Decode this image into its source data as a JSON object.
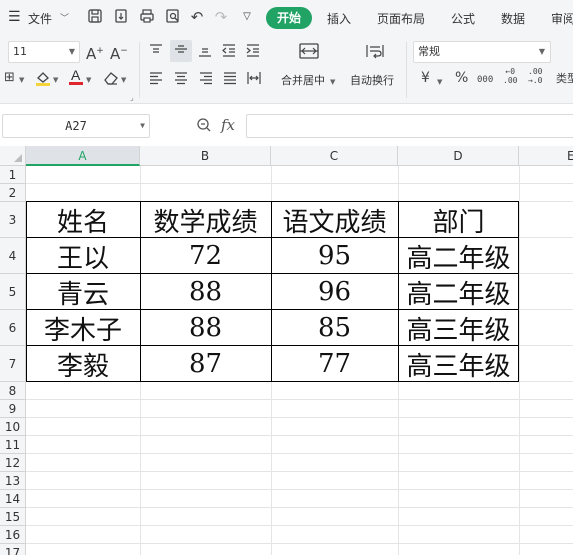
{
  "menubar": {
    "menu_icon": "hamburger-icon",
    "file_label": "文件",
    "tabs": [
      "开始",
      "插入",
      "页面布局",
      "公式",
      "数据",
      "审阅"
    ],
    "active_tab": "开始"
  },
  "ribbon": {
    "font_size": "11",
    "number_format": "常规",
    "merge_center_label": "合并居中",
    "wrap_text_label": "自动换行",
    "currency_symbol": "¥",
    "percent_symbol": "%",
    "thousands_symbol": "000",
    "inc_decimal": "←0\n.00",
    "dec_decimal": ".00\n→.0",
    "more_label": "类型",
    "font_color": "#e0262d",
    "fill_color": "#f5d33a",
    "accent_color": "#21a366"
  },
  "formula_bar": {
    "name_box": "A27",
    "fx_label": "fx",
    "formula": ""
  },
  "sheet": {
    "columns": [
      "A",
      "B",
      "C",
      "D",
      "E"
    ],
    "selected_column": "A",
    "rows": [
      "1",
      "2",
      "3",
      "4",
      "5",
      "6",
      "7",
      "8",
      "9",
      "10",
      "11",
      "12",
      "13",
      "14",
      "15",
      "16",
      "17"
    ],
    "headers": [
      "姓名",
      "数学成绩",
      "语文成绩",
      "部门"
    ],
    "data": [
      [
        "王以",
        "72",
        "95",
        "高二年级"
      ],
      [
        "青云",
        "88",
        "96",
        "高二年级"
      ],
      [
        "李木子",
        "88",
        "85",
        "高三年级"
      ],
      [
        "李毅",
        "87",
        "77",
        "高三年级"
      ]
    ]
  }
}
